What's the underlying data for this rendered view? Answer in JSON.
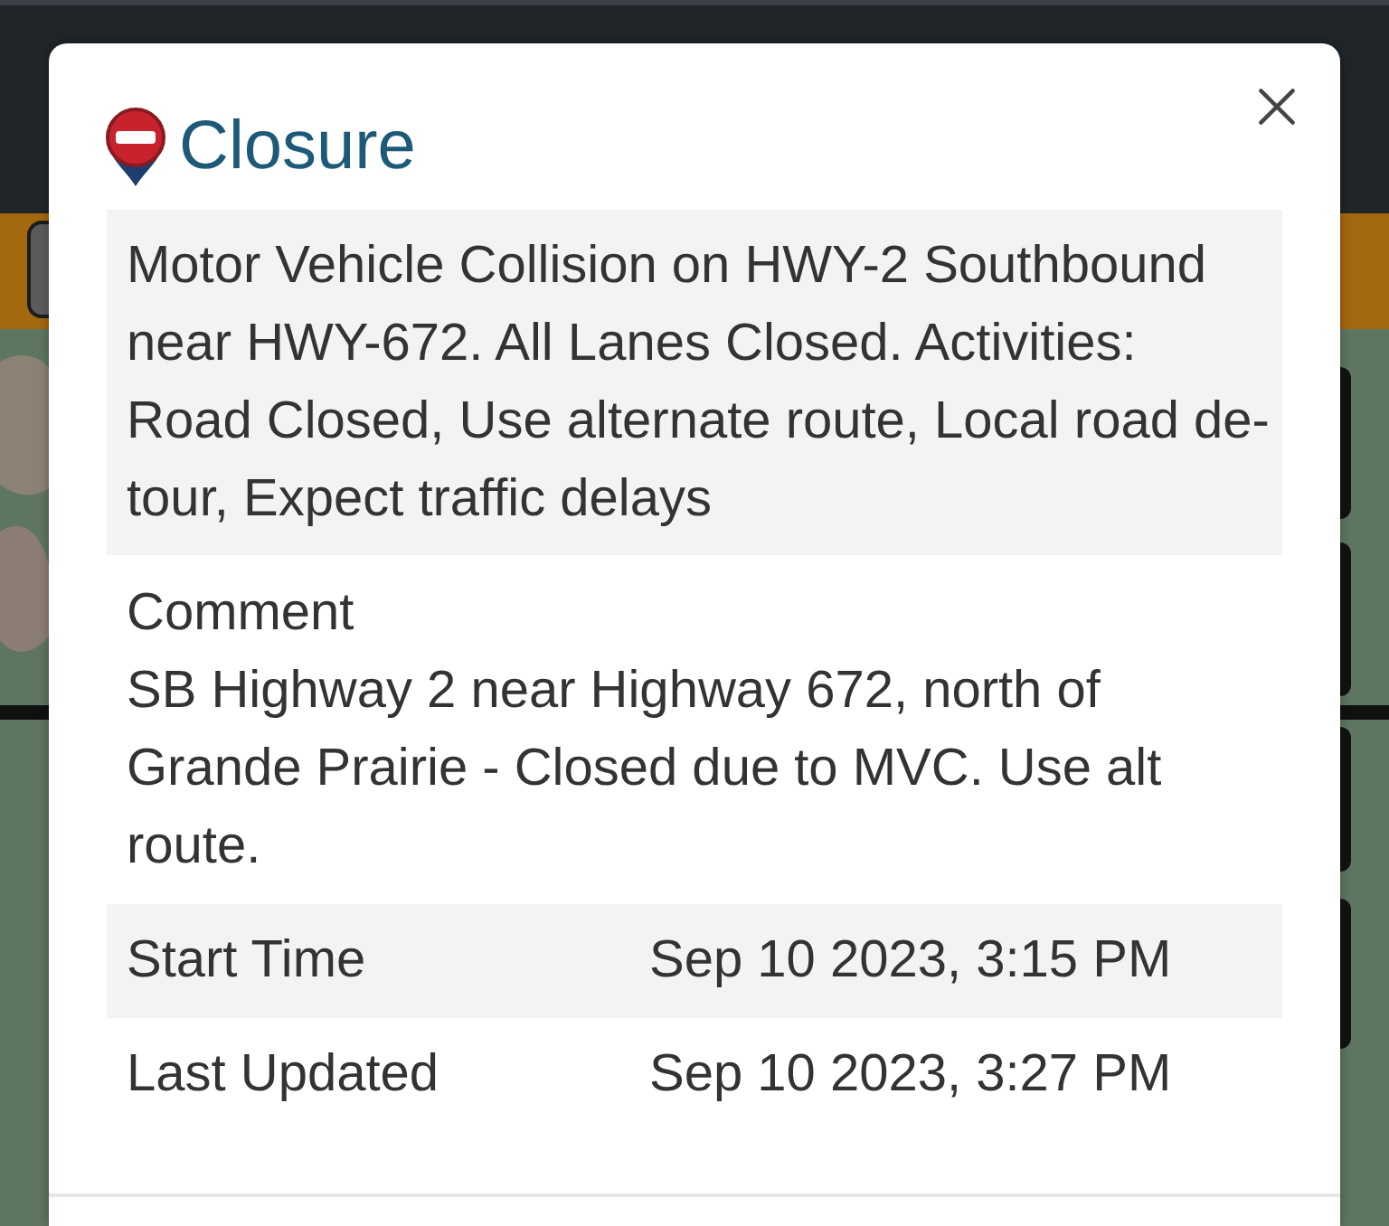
{
  "dialog": {
    "title": "Closure",
    "description": "Motor Vehicle Collision on HWY-2 Southbound near HWY-672. All Lanes Closed. Activities: Road Closed, Use alternate route, Local road de-tour, Expect traffic delays",
    "comment": {
      "label": "Comment",
      "text": "SB Highway 2 near Highway 672, north of Grande Prairie - Closed due to MVC. Use alt route."
    },
    "details": [
      {
        "label": "Start Time",
        "value": "Sep 10 2023, 3:15 PM"
      },
      {
        "label": "Last Updated",
        "value": "Sep 10 2023, 3:27 PM"
      }
    ]
  }
}
